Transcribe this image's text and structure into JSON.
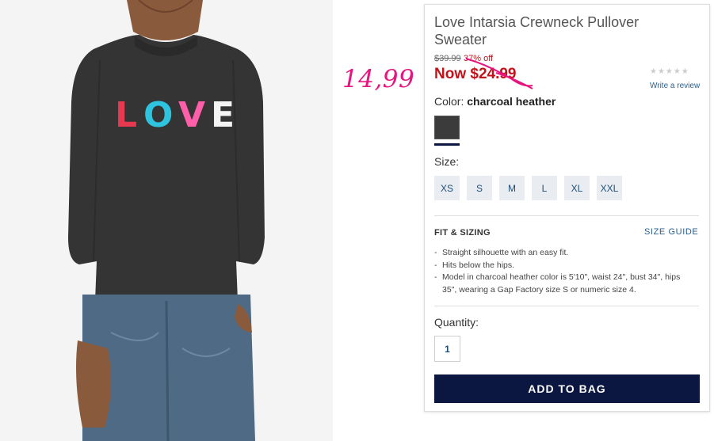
{
  "product": {
    "title": "Love Intarsia Crewneck Pullover Sweater",
    "handwritten_price": "14,99",
    "original_price": "$39.99",
    "discount": "37% off",
    "now_price": "Now $24.99",
    "rating_stars": "★★★★★",
    "write_review": "Write a review",
    "image_text": "LOVE"
  },
  "color": {
    "label": "Color:",
    "value": "charcoal heather",
    "swatch_hex": "#3b3b3b"
  },
  "size": {
    "label": "Size:",
    "options": [
      "XS",
      "S",
      "M",
      "L",
      "XL",
      "XXL"
    ]
  },
  "fit": {
    "title": "FIT & SIZING",
    "guide_link": "SIZE GUIDE",
    "bullets": [
      "Straight silhouette with an easy fit.",
      "Hits below the hips.",
      "Model in charcoal heather color is 5'10\", waist 24\", bust 34\", hips 35\", wearing a Gap Factory size S or numeric size 4."
    ]
  },
  "quantity": {
    "label": "Quantity:",
    "value": "1"
  },
  "cta": {
    "add_to_bag": "ADD TO BAG"
  },
  "colors": {
    "sale_red": "#c4121b",
    "handwriting_pink": "#e8157e",
    "navy": "#0b1740",
    "link_blue": "#2a5e8c"
  }
}
